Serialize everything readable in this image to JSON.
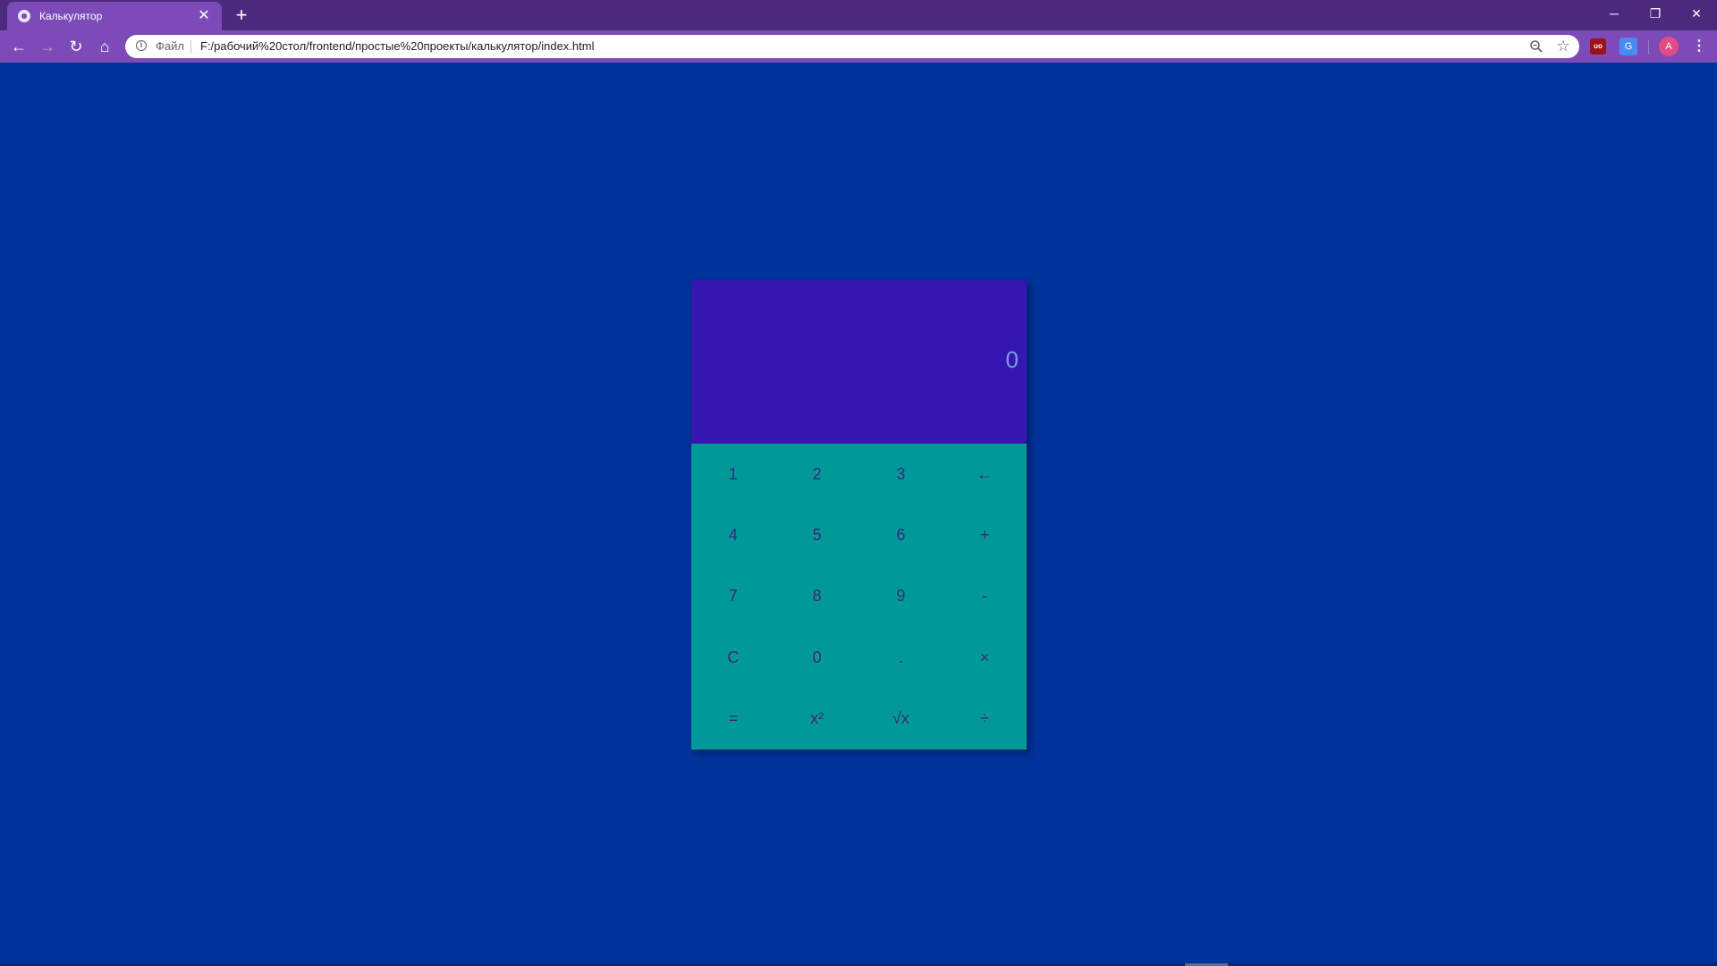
{
  "browser": {
    "tab": {
      "title": "Калькулятор",
      "close_glyph": "✕",
      "favicon": "globe-icon"
    },
    "new_tab_glyph": "+",
    "window_controls": {
      "minimize": "─",
      "restore": "❐",
      "close": "✕"
    },
    "nav": {
      "back": "←",
      "forward": "→",
      "reload": "↻",
      "home": "⌂"
    },
    "omnibox": {
      "info_glyph": "i",
      "scheme_label": "Файл",
      "url": "F:/рабочий%20стол/frontend/простые%20проекты/калькулятор/index.html",
      "star_glyph": "☆"
    },
    "extensions": {
      "ublock_label": "uo",
      "translate_label": "G"
    },
    "profile_initial": "A",
    "menu_glyph": "⋮"
  },
  "colors": {
    "page_background": "#00349c",
    "chrome": "#4b2a7d",
    "toolbar": "#7c4bb8",
    "display": "#3616b0",
    "keypad": "#019898",
    "key_text": "#3b2a80",
    "display_text": "#7a9ae2"
  },
  "calculator": {
    "display_value": "0",
    "keys": [
      {
        "label": "1"
      },
      {
        "label": "2"
      },
      {
        "label": "3"
      },
      {
        "label": "←"
      },
      {
        "label": "4"
      },
      {
        "label": "5"
      },
      {
        "label": "6"
      },
      {
        "label": "+"
      },
      {
        "label": "7"
      },
      {
        "label": "8"
      },
      {
        "label": "9"
      },
      {
        "label": "-"
      },
      {
        "label": "C"
      },
      {
        "label": "0"
      },
      {
        "label": "."
      },
      {
        "label": "×"
      },
      {
        "label": "="
      },
      {
        "label": "x²"
      },
      {
        "label": "√x"
      },
      {
        "label": "÷"
      }
    ]
  }
}
